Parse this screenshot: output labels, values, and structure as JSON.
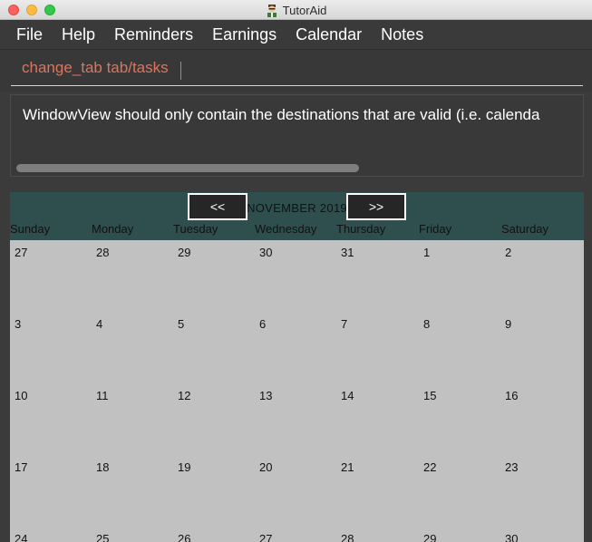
{
  "window": {
    "title": "TutorAid",
    "app_icon": "tutor-avatar-icon"
  },
  "menu": [
    "File",
    "Help",
    "Reminders",
    "Earnings",
    "Calendar",
    "Notes"
  ],
  "command": {
    "value": "change_tab tab/tasks"
  },
  "result": {
    "text": "WindowView should only contain the destinations that are valid (i.e. calenda"
  },
  "calendar": {
    "month_label": "NOVEMBER 2019",
    "prev_label": "<<",
    "next_label": ">>",
    "weekdays": [
      "Sunday",
      "Monday",
      "Tuesday",
      "Wednesday",
      "Thursday",
      "Friday",
      "Saturday"
    ],
    "weeks": [
      [
        "27",
        "28",
        "29",
        "30",
        "31",
        "1",
        "2"
      ],
      [
        "3",
        "4",
        "5",
        "6",
        "7",
        "8",
        "9"
      ],
      [
        "10",
        "11",
        "12",
        "13",
        "14",
        "15",
        "16"
      ],
      [
        "17",
        "18",
        "19",
        "20",
        "21",
        "22",
        "23"
      ],
      [
        "24",
        "25",
        "26",
        "27",
        "28",
        "29",
        "30"
      ]
    ]
  }
}
